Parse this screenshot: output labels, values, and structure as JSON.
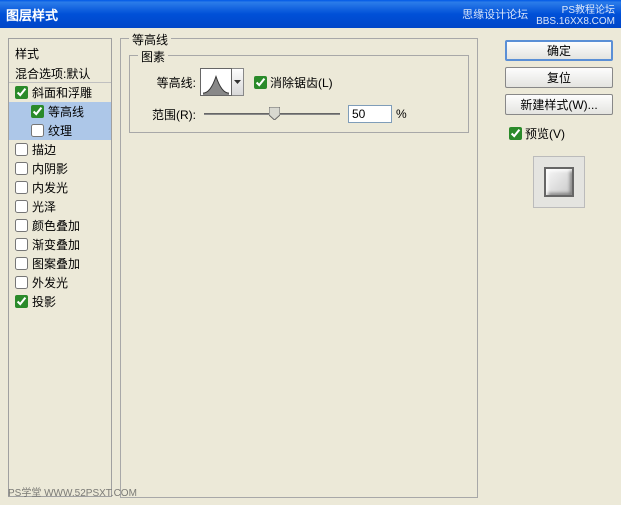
{
  "window": {
    "title": "图层样式",
    "watermark1": "思缘设计论坛",
    "watermark2": "PS教程论坛",
    "watermark3": "BBS.16XX8.COM"
  },
  "sidebar": {
    "header": "样式",
    "blend": "混合选项:默认",
    "items": [
      {
        "label": "斜面和浮雕",
        "checked": true
      },
      {
        "label": "等高线",
        "checked": true,
        "selected": true,
        "indent": true
      },
      {
        "label": "纹理",
        "checked": false,
        "indent": true
      },
      {
        "label": "描边",
        "checked": false
      },
      {
        "label": "内阴影",
        "checked": false
      },
      {
        "label": "内发光",
        "checked": false
      },
      {
        "label": "光泽",
        "checked": false
      },
      {
        "label": "颜色叠加",
        "checked": false
      },
      {
        "label": "渐变叠加",
        "checked": false
      },
      {
        "label": "图案叠加",
        "checked": false
      },
      {
        "label": "外发光",
        "checked": false
      },
      {
        "label": "投影",
        "checked": true
      }
    ]
  },
  "main": {
    "group_outer": "等高线",
    "group_inner": "图素",
    "contour_label": "等高线:",
    "antialiased_label": "消除锯齿(L)",
    "range_label": "范围(R):",
    "range_value": "50",
    "range_unit": "%"
  },
  "buttons": {
    "ok": "确定",
    "cancel": "复位",
    "new_style": "新建样式(W)...",
    "preview": "预览(V)"
  },
  "footer": "PS学堂  WWW.52PSXT.COM"
}
